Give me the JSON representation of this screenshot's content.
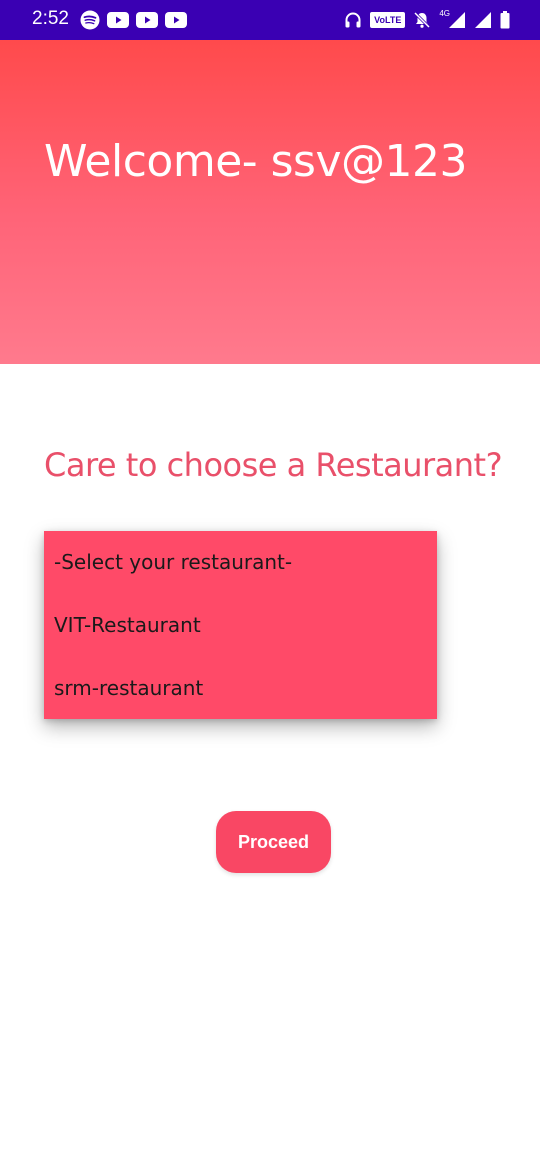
{
  "status_bar": {
    "time": "2:52",
    "volte": "VoLTE",
    "network": "4G",
    "background_color": "#3a00b3",
    "left_icons": [
      "spotify-icon",
      "youtube-icon",
      "youtube-icon",
      "youtube-icon"
    ],
    "right_icons": [
      "headphones-icon",
      "volte-icon",
      "mute-bell-icon",
      "signal-icon",
      "signal-icon",
      "battery-icon"
    ]
  },
  "header": {
    "welcome_text": "Welcome- ssv@123",
    "gradient_top": "#ff4a4c",
    "gradient_bottom": "#ff7a8d"
  },
  "main": {
    "question": "Care to choose a Restaurant?",
    "question_color": "#e9506a",
    "dropdown": {
      "background_color": "#ff4a68",
      "options": [
        "-Select your restaurant-",
        "VIT-Restaurant",
        "srm-restaurant"
      ]
    },
    "proceed_label": "Proceed",
    "proceed_color": "#f94764"
  }
}
